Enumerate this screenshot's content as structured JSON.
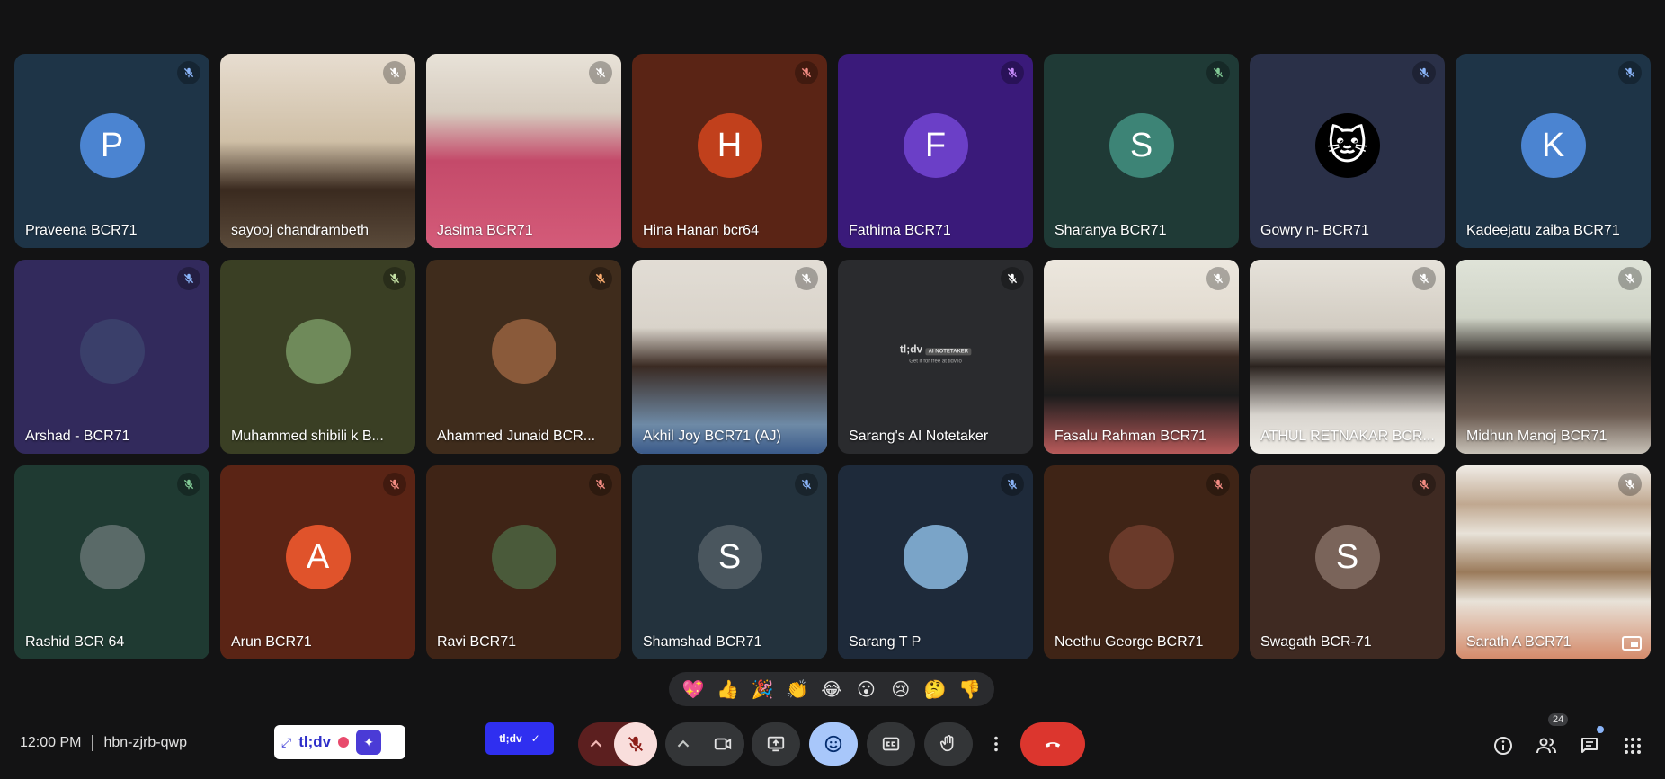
{
  "participants": [
    {
      "name": "Praveena BCR71",
      "initial": "P",
      "bg": "#1e3447",
      "avatar": "#4b84d1",
      "mic": "#8ab4f8"
    },
    {
      "name": "sayooj chandrambeth",
      "bg": "#9b8a73",
      "video": "linear-gradient(180deg,#e7ddd0 0%,#cfbfa6 45%,#3a2a1f 70%,#5a4a3a 100%)",
      "mic": "#ffffff"
    },
    {
      "name": "Jasima BCR71",
      "bg": "#cfc7bb",
      "video": "linear-gradient(180deg,#e8e2d8 0%,#d6ccbf 30%,#c44a6a 55%,#d45b79 100%)",
      "mic": "#ffffff"
    },
    {
      "name": "Hina Hanan bcr64",
      "initial": "H",
      "bg": "#5a2415",
      "avatar": "#c1401c",
      "mic": "#f28b82"
    },
    {
      "name": "Fathima BCR71",
      "initial": "F",
      "bg": "#3a1a7a",
      "avatar": "#6b3fc7",
      "mic": "#c58af9"
    },
    {
      "name": "Sharanya BCR71",
      "initial": "S",
      "bg": "#1f3a36",
      "avatar": "#3d8476",
      "mic": "#81c995"
    },
    {
      "name": "Gowry n- BCR71",
      "bg": "#2a3048",
      "avatar": "#000000",
      "avatarGlyph": "🐱",
      "mic": "#8ab4f8"
    },
    {
      "name": "Kadeejatu zaiba BCR71",
      "initial": "K",
      "bg": "#1e3447",
      "avatar": "#4b84d1",
      "mic": "#8ab4f8"
    },
    {
      "name": "Arshad - BCR71",
      "bg": "#322a5c",
      "avatar": "#3a3f6a",
      "mic": "#8ab4f8"
    },
    {
      "name": "Muhammed shibili k B...",
      "bg": "#3a3f24",
      "avatar": "#6f8a5a",
      "mic": "#c5e1a5"
    },
    {
      "name": "Ahammed Junaid BCR...",
      "bg": "#3f2c1c",
      "avatar": "#8a5a3a",
      "mic": "#fcad70"
    },
    {
      "name": "Akhil Joy BCR71 (AJ)",
      "bg": "#cfcac2",
      "video": "linear-gradient(180deg,#e2ddd5 0%,#d9d3ca 35%,#3a2a22 55%,#6e8aa6 85%,#3a5a8a 100%)",
      "mic": "#ffffff"
    },
    {
      "name": "Sarang's AI Notetaker",
      "bg": "#2a2b2e",
      "mic": "#ffffff",
      "notetaker": "tl;dv",
      "notetakerTag": "AI NOTETAKER",
      "notetakerSub": "Get it for free at tldv.io"
    },
    {
      "name": "Fasalu Rahman BCR71",
      "bg": "#d8d2c6",
      "video": "linear-gradient(180deg,#ece7de 0%,#e2dbd0 30%,#3a2a22 50%,#1c1c1c 70%,#b85a5a 100%)",
      "mic": "#ffffff"
    },
    {
      "name": "ATHUL RETNAKAR BCR...",
      "bg": "#c9c4bb",
      "video": "linear-gradient(180deg,#e6e2da 0%,#d2ccc2 35%,#2a221e 55%,#d8d4ce 80%,#efece6 100%)",
      "mic": "#ffffff"
    },
    {
      "name": "Midhun Manoj BCR71",
      "bg": "#bfc4b8",
      "video": "linear-gradient(180deg,#dfe3d8 0%,#cfd3c6 30%,#2a2420 50%,#6a5a50 80%,#c8c2b8 100%)",
      "mic": "#ffffff"
    },
    {
      "name": "Rashid BCR 64",
      "bg": "#1f3a32",
      "avatar": "#5a6a68",
      "mic": "#81c995"
    },
    {
      "name": "Arun BCR71",
      "initial": "A",
      "bg": "#5a2415",
      "avatar": "#e0532b",
      "mic": "#f28b82"
    },
    {
      "name": "Ravi BCR71",
      "bg": "#3f2416",
      "avatar": "#4a5a3a",
      "mic": "#f28b82"
    },
    {
      "name": "Shamshad BCR71",
      "initial": "S",
      "bg": "#23323d",
      "avatar": "#4a565e",
      "mic": "#8ab4f8"
    },
    {
      "name": "Sarang T P",
      "bg": "#1e2a3a",
      "avatar": "#7aa4c8",
      "mic": "#8ab4f8"
    },
    {
      "name": "Neethu George BCR71",
      "bg": "#3f2416",
      "avatar": "#6a3a2a",
      "mic": "#f28b82"
    },
    {
      "name": "Swagath BCR-71",
      "initial": "S",
      "bg": "#3f2a22",
      "avatar": "#7a645a",
      "mic": "#f28b82"
    },
    {
      "name": "Sarath A BCR71",
      "bg": "#d9cfc0",
      "video": "linear-gradient(180deg,#f0ece6 0%,#c0a890 20%,#e8e2d8 35%,#9a7a5a 55%,#e8e2d8 70%,#d48a6a 100%)",
      "mic": "#ffffff",
      "pip": true
    }
  ],
  "reactions": [
    "💖",
    "👍",
    "🎉",
    "👏",
    "😂",
    "😮",
    "😢",
    "🤔",
    "👎"
  ],
  "meeting": {
    "time": "12:00 PM",
    "code": "hbn-zjrb-qwp"
  },
  "extension": {
    "logo": "tl;dv",
    "badge": "tl;dv",
    "badge_check": "✓"
  },
  "people_count": "24",
  "colors": {
    "background": "#131314",
    "leave": "#dc362e",
    "emoji_active": "#a8c7fa",
    "mic_off": "#f9dedc"
  }
}
